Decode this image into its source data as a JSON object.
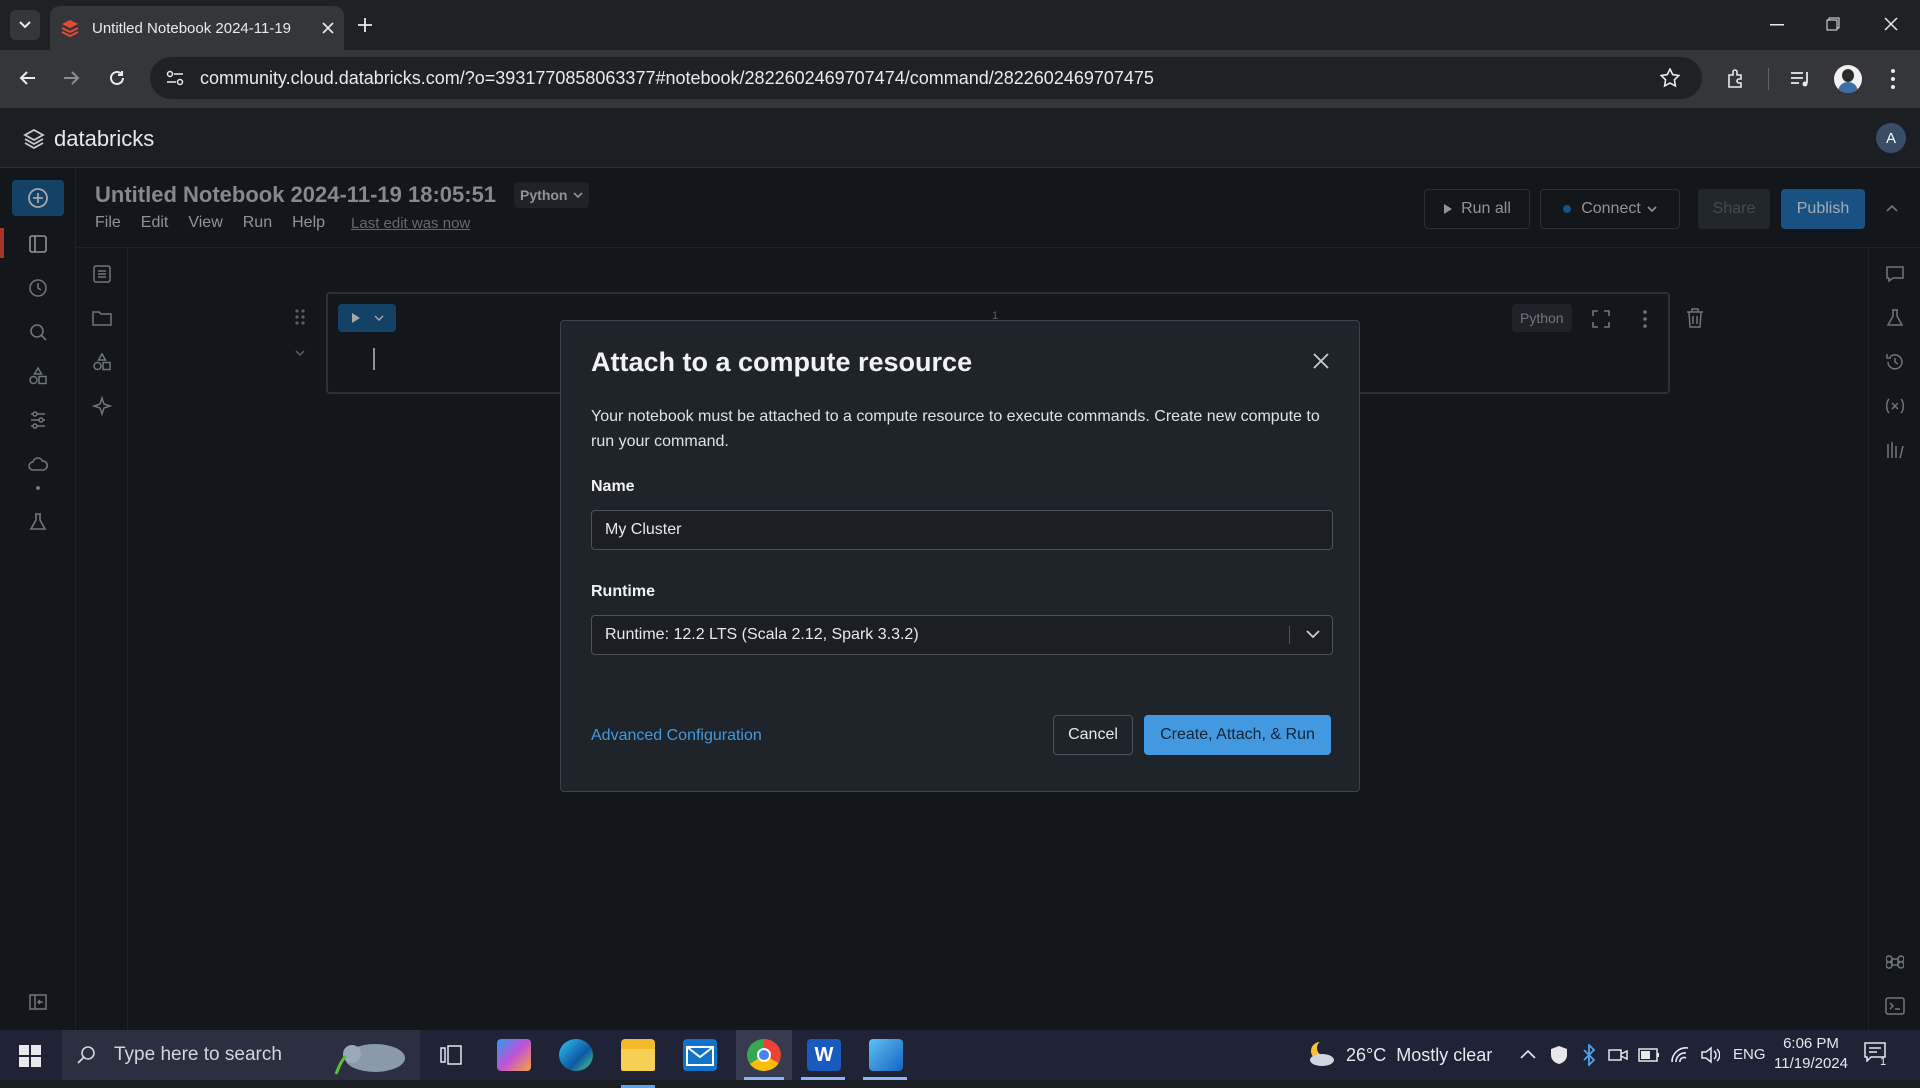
{
  "browser": {
    "tab_title": "Untitled Notebook 2024-11-19",
    "url": "community.cloud.databricks.com/?o=3931770858063377#notebook/2822602469707474/command/2822602469707475"
  },
  "app": {
    "brand": "databricks",
    "avatar_initial": "A"
  },
  "notebook": {
    "title": "Untitled Notebook 2024-11-19 18:05:51",
    "language": "Python",
    "menu": [
      "File",
      "Edit",
      "View",
      "Run",
      "Help"
    ],
    "last_edit": "Last edit was now",
    "run_all": "Run all",
    "connect": "Connect",
    "share": "Share",
    "publish": "Publish",
    "cell_language": "Python",
    "cell_line_number": "1"
  },
  "modal": {
    "title": "Attach to a compute resource",
    "description": "Your notebook must be attached to a compute resource to execute commands. Create new compute to run your command.",
    "name_label": "Name",
    "name_value": "My Cluster",
    "runtime_label": "Runtime",
    "runtime_value": "Runtime: 12.2 LTS (Scala 2.12, Spark 3.3.2)",
    "advanced": "Advanced Configuration",
    "cancel": "Cancel",
    "primary": "Create, Attach, & Run"
  },
  "taskbar": {
    "search_placeholder": "Type here to search",
    "weather": "26°C  Mostly clear",
    "language": "ENG",
    "time": "6:06 PM",
    "date": "11/19/2024",
    "notification_count": "1"
  },
  "colors": {
    "accent": "#2272b4",
    "primary_button": "#4299e0",
    "link": "#4299e0",
    "tab_favicon": "#e8483a"
  }
}
